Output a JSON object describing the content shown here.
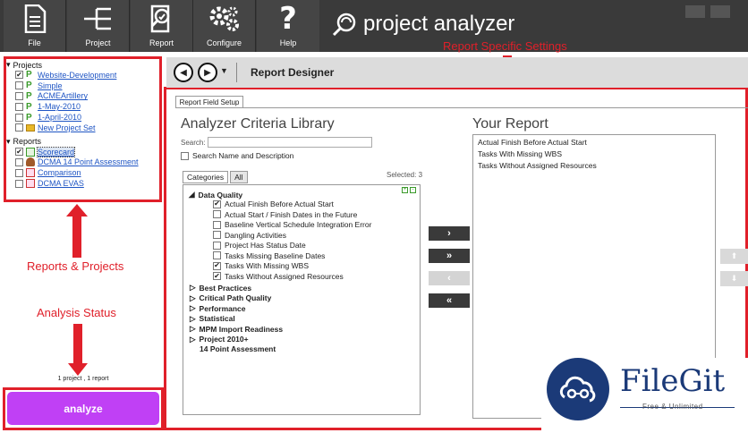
{
  "toolbar": {
    "buttons": [
      {
        "label": "File",
        "icon": "document-icon"
      },
      {
        "label": "Project",
        "icon": "hierarchy-icon"
      },
      {
        "label": "Report",
        "icon": "report-magnifier-icon"
      },
      {
        "label": "Configure",
        "icon": "gears-icon"
      },
      {
        "label": "Help",
        "icon": "question-icon"
      }
    ],
    "brand": "project analyzer"
  },
  "tree": {
    "projects_header": "Projects",
    "projects": [
      {
        "label": "Website-Development",
        "checked": true
      },
      {
        "label": "Simple",
        "checked": false
      },
      {
        "label": "ACMEArtillery",
        "checked": false
      },
      {
        "label": "1-May-2010",
        "checked": false
      },
      {
        "label": "1-April-2010",
        "checked": false
      },
      {
        "label": "New Project Set",
        "checked": false
      }
    ],
    "reports_header": "Reports",
    "reports": [
      {
        "label": "Scorecard",
        "checked": true
      },
      {
        "label": "DCMA 14 Point Assessment",
        "checked": false
      },
      {
        "label": "Comparison",
        "checked": false
      },
      {
        "label": "DCMA EVAS",
        "checked": false
      }
    ]
  },
  "annotations": {
    "reports_projects": "Reports & Projects",
    "analysis_status": "Analysis Status",
    "report_settings": "Report Specific Settings"
  },
  "status": "1 project , 1 report",
  "analyze_label": "analyze",
  "designer": {
    "title": "Report Designer",
    "tab": "Report Field Setup",
    "library_title": "Analyzer Criteria Library",
    "search_label": "Search:",
    "search_value": "",
    "search_names_label": "Search Name and Description",
    "cat_tabs": [
      "Categories",
      "All"
    ],
    "selected_label": "Selected: 3",
    "groups": [
      {
        "label": "Data Quality",
        "expanded": true,
        "items": [
          {
            "label": "Actual Finish Before Actual Start",
            "checked": true
          },
          {
            "label": "Actual Start / Finish Dates in the Future",
            "checked": false
          },
          {
            "label": "Baseline Vertical Schedule Integration Error",
            "checked": false
          },
          {
            "label": "Dangling Activities",
            "checked": false
          },
          {
            "label": "Project Has Status Date",
            "checked": false
          },
          {
            "label": "Tasks Missing Baseline Dates",
            "checked": false
          },
          {
            "label": "Tasks With Missing WBS",
            "checked": true
          },
          {
            "label": "Tasks Without Assigned Resources",
            "checked": true
          }
        ]
      },
      {
        "label": "Best Practices",
        "expanded": false
      },
      {
        "label": "Critical Path Quality",
        "expanded": false
      },
      {
        "label": "Performance",
        "expanded": false
      },
      {
        "label": "Statistical",
        "expanded": false
      },
      {
        "label": "MPM Import Readiness",
        "expanded": false
      },
      {
        "label": "Project 2010+",
        "expanded": false
      },
      {
        "label": "14 Point Assessment",
        "expanded": null
      }
    ],
    "move_buttons": [
      {
        "label": "›",
        "enabled": true
      },
      {
        "label": "»",
        "enabled": true
      },
      {
        "label": "‹",
        "enabled": false
      },
      {
        "label": "«",
        "enabled": true
      }
    ],
    "your_report_title": "Your Report",
    "your_report_items": [
      "Actual Finish Before Actual Start",
      "Tasks With Missing WBS",
      "Tasks Without Assigned Resources"
    ]
  },
  "watermark": {
    "name": "FileGit",
    "tagline": "Free & Unlimited"
  },
  "colors": {
    "accent_red": "#e0202a",
    "analyze_purple": "#c040f5",
    "toolbar": "#3a3a3a",
    "watermark_blue": "#1b3a78"
  }
}
